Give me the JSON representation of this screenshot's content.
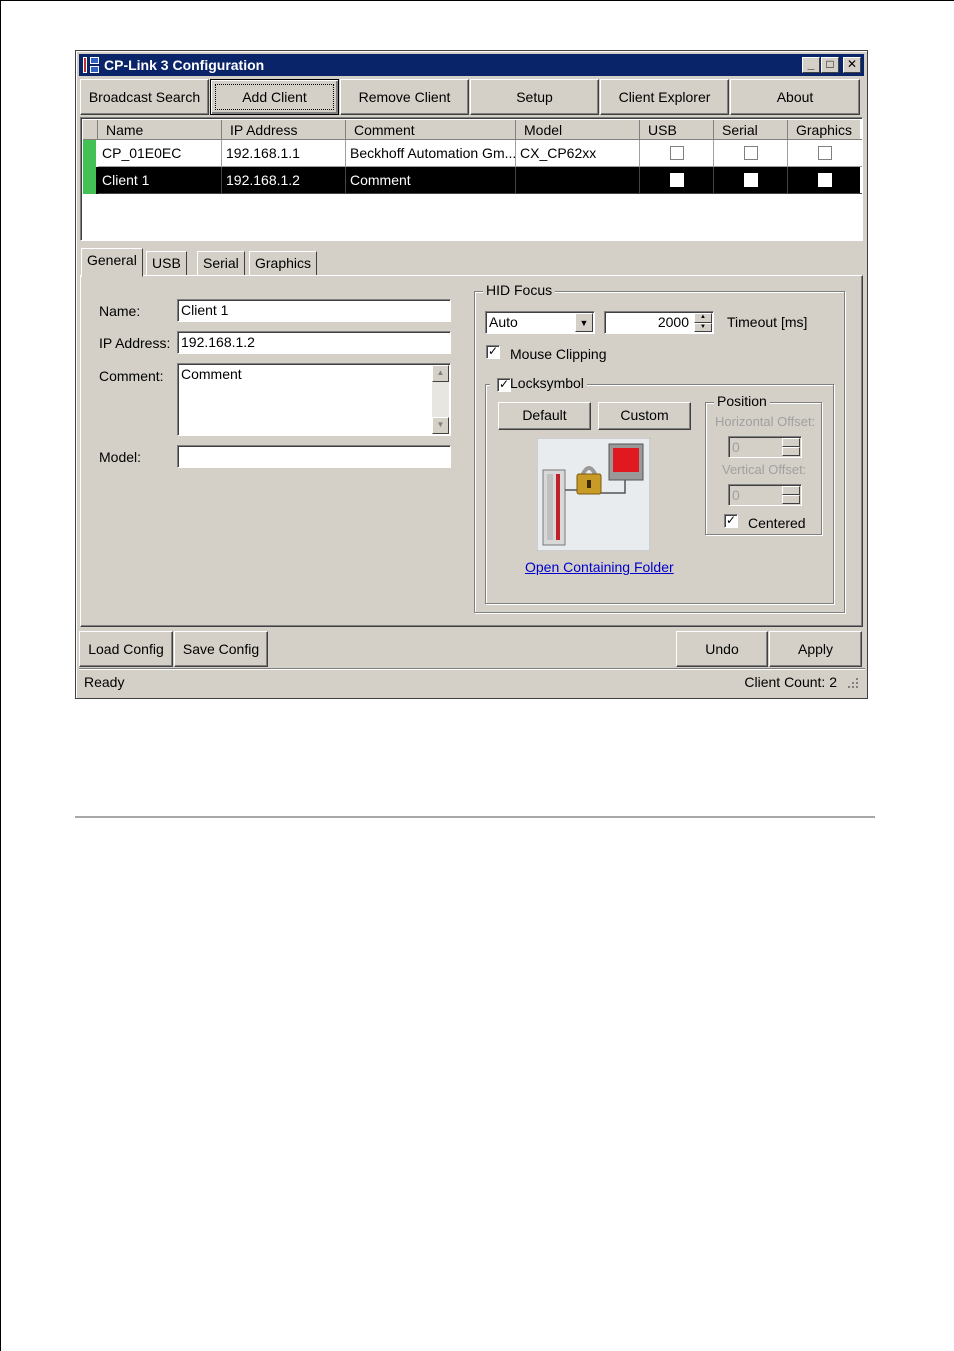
{
  "window": {
    "title": "CP-Link 3 Configuration",
    "controls": {
      "minimize": "_",
      "maximize": "□",
      "close": "✕"
    }
  },
  "toolbar": {
    "buttons": [
      "Broadcast Search",
      "Add Client",
      "Remove Client",
      "Setup",
      "Client Explorer",
      "About"
    ]
  },
  "client_table": {
    "columns": [
      "Name",
      "IP Address",
      "Comment",
      "Model",
      "USB",
      "Serial",
      "Graphics"
    ],
    "rows": [
      {
        "name": "CP_01E0EC",
        "ip": "192.168.1.1",
        "comment": "Beckhoff Automation Gm...",
        "model": "CX_CP62xx",
        "usb": false,
        "serial": false,
        "graphics": false,
        "selected": false
      },
      {
        "name": "Client 1",
        "ip": "192.168.1.2",
        "comment": "Comment",
        "model": "",
        "usb": false,
        "serial": false,
        "graphics": false,
        "selected": true
      }
    ]
  },
  "tabs": [
    "General",
    "USB",
    "Serial",
    "Graphics"
  ],
  "active_tab": "General",
  "general": {
    "name_label": "Name:",
    "name_value": "Client 1",
    "ip_label": "IP Address:",
    "ip_value": "192.168.1.2",
    "comment_label": "Comment:",
    "comment_value": "Comment",
    "model_label": "Model:",
    "model_value": ""
  },
  "hid_focus": {
    "title": "HID Focus",
    "mode_value": "Auto",
    "timeout_value": "2000",
    "timeout_label": "Timeout [ms]",
    "mouse_clipping_label": "Mouse Clipping",
    "mouse_clipping_checked": true,
    "locksymbol": {
      "title": "Locksymbol",
      "checked": true,
      "default_button": "Default",
      "custom_button": "Custom",
      "open_folder_link": "Open Containing Folder"
    },
    "position": {
      "title": "Position",
      "horizontal_label": "Horizontal Offset:",
      "horizontal_value": "0",
      "vertical_label": "Vertical Offset:",
      "vertical_value": "0",
      "centered_label": "Centered",
      "centered_checked": true
    }
  },
  "bottom_buttons": {
    "load": "Load Config",
    "save": "Save Config",
    "undo": "Undo",
    "apply": "Apply"
  },
  "status": {
    "left": "Ready",
    "right": "Client Count: 2"
  },
  "colors": {
    "face": "#d4d0c8",
    "title_bar": "#0a246a",
    "row_marker": "#44c155",
    "selection": "#000000",
    "link": "#0000cc"
  },
  "icons": [
    "app-icon",
    "minimize-icon",
    "maximize-icon",
    "close-icon",
    "dropdown-arrow-icon",
    "spin-up-icon",
    "spin-down-icon",
    "lock-preview-image",
    "size-grip-icon"
  ]
}
